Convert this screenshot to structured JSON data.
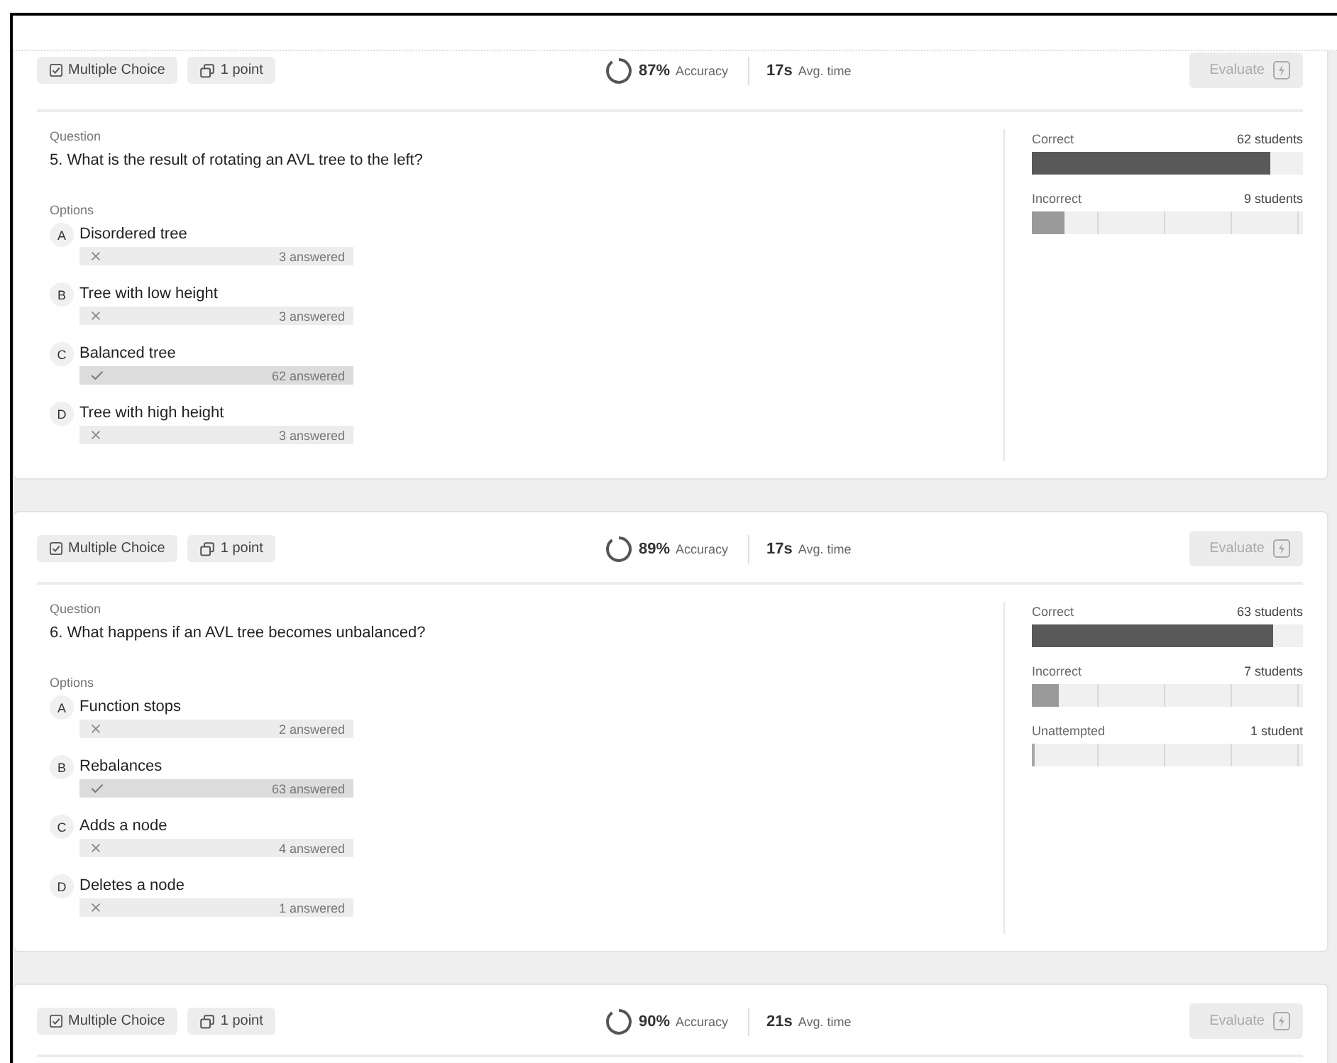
{
  "questions": [
    {
      "type_tag": "Multiple Choice",
      "points_tag": "1 point",
      "accuracy": {
        "value": "87%",
        "label": "Accuracy"
      },
      "time": {
        "value": "17s",
        "label": "Avg. time"
      },
      "evaluate": {
        "label": "Evaluate",
        "disabled": true
      },
      "question_label": "Question",
      "question": "5. What is the result of rotating an AVL tree to the left?",
      "options_label": "Options",
      "options": [
        {
          "letter": "A",
          "text": "Disordered tree",
          "correct": false,
          "count": "3 answered"
        },
        {
          "letter": "B",
          "text": "Tree with low height",
          "correct": false,
          "count": "3 answered"
        },
        {
          "letter": "C",
          "text": "Balanced tree",
          "correct": true,
          "count": "62 answered"
        },
        {
          "letter": "D",
          "text": "Tree with high height",
          "correct": false,
          "count": "3 answered"
        }
      ],
      "stats": [
        {
          "kind": "correct",
          "label": "Correct",
          "count": "62 students",
          "level": 0.88
        },
        {
          "kind": "incorrect",
          "label": "Incorrect",
          "count": "9 students",
          "level": 0.12
        }
      ]
    },
    {
      "type_tag": "Multiple Choice",
      "points_tag": "1 point",
      "accuracy": {
        "value": "89%",
        "label": "Accuracy"
      },
      "time": {
        "value": "17s",
        "label": "Avg. time"
      },
      "evaluate": {
        "label": "Evaluate",
        "disabled": true
      },
      "question_label": "Question",
      "question": "6. What happens if an AVL tree becomes unbalanced?",
      "options_label": "Options",
      "options": [
        {
          "letter": "A",
          "text": "Function stops",
          "correct": false,
          "count": "2 answered"
        },
        {
          "letter": "B",
          "text": "Rebalances",
          "correct": true,
          "count": "63 answered"
        },
        {
          "letter": "C",
          "text": "Adds a node",
          "correct": false,
          "count": "4 answered"
        },
        {
          "letter": "D",
          "text": "Deletes a node",
          "correct": false,
          "count": "1 answered"
        }
      ],
      "stats": [
        {
          "kind": "correct",
          "label": "Correct",
          "count": "63 students",
          "level": 0.89
        },
        {
          "kind": "incorrect",
          "label": "Incorrect",
          "count": "7 students",
          "level": 0.1
        },
        {
          "kind": "unattempted",
          "label": "Unattempted",
          "count": "1 student",
          "level": 0.01
        }
      ]
    },
    {
      "type_tag": "Multiple Choice",
      "points_tag": "1 point",
      "accuracy": {
        "value": "90%",
        "label": "Accuracy"
      },
      "time": {
        "value": "21s",
        "label": "Avg. time"
      },
      "evaluate": {
        "label": "Evaluate",
        "disabled": true
      }
    }
  ]
}
